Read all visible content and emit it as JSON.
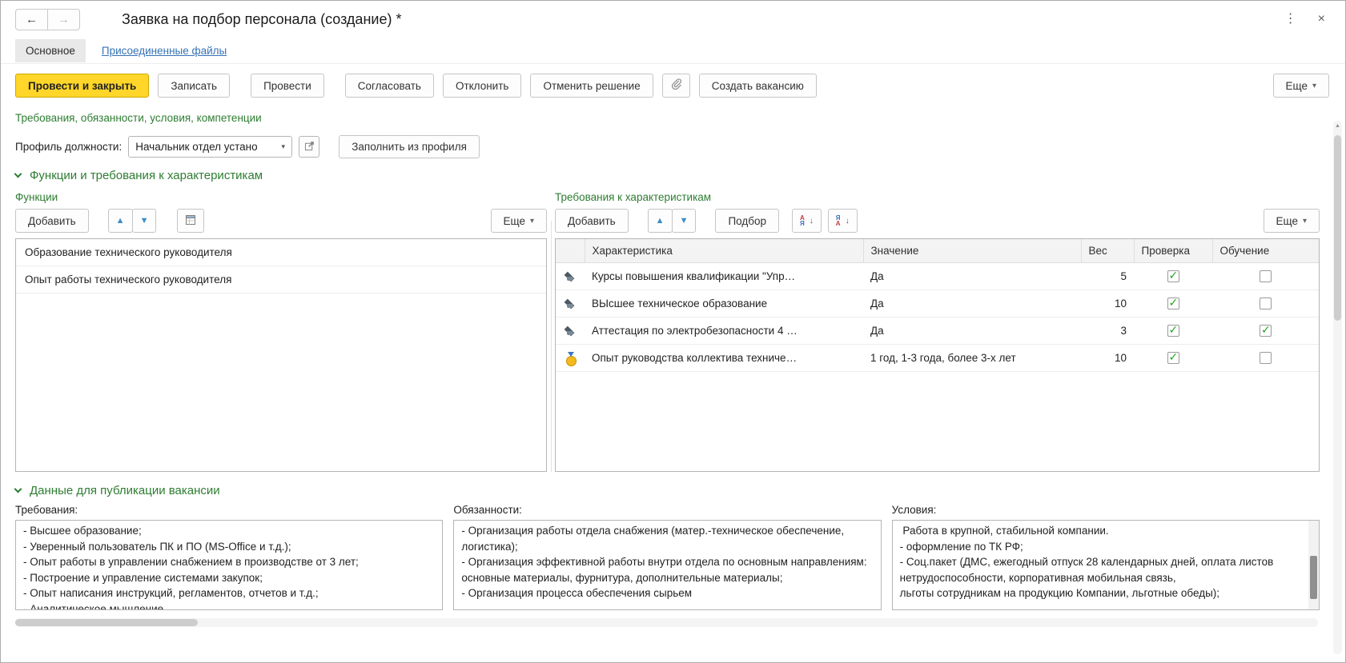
{
  "header": {
    "title": "Заявка на подбор персонала (создание) *"
  },
  "icons": {
    "back": "←",
    "forward": "→",
    "menu_dots": "⋮",
    "close": "×",
    "caret": "▾",
    "up": "▲",
    "down": "▼",
    "scroll_up": "▲",
    "sort_asc_top": "А",
    "sort_asc_bottom": "Я",
    "sort_desc_top": "Я",
    "sort_desc_bottom": "А",
    "sort_arrow": "↓",
    "check": "✓",
    "paperclip": "paperclip-icon",
    "open": "open-icon",
    "list_settings": "list-settings-icon",
    "education": "graduation-cap-icon",
    "medal": "medal-icon",
    "chevron": "chevron-down-icon"
  },
  "tabs": [
    {
      "label": "Основное",
      "active": true
    },
    {
      "label": "Присоединенные файлы",
      "active": false
    }
  ],
  "toolbar": {
    "submit_close": "Провести и закрыть",
    "save": "Записать",
    "post": "Провести",
    "approve": "Согласовать",
    "reject": "Отклонить",
    "cancel_decision": "Отменить решение",
    "create_vacancy": "Создать вакансию",
    "more": "Еще"
  },
  "links": {
    "requirements_link": "Требования, обязанности, условия, компетенции"
  },
  "profile": {
    "label": "Профиль должности:",
    "value": "Начальник отдел устано",
    "fill_button": "Заполнить из профиля"
  },
  "sections": {
    "functions_requirements": "Функции и требования к характеристикам",
    "vacancy_publication": "Данные для публикации вакансии"
  },
  "functions": {
    "title": "Функции",
    "add": "Добавить",
    "more": "Еще",
    "items": [
      "Образование технического руководителя",
      "Опыт работы технического руководителя"
    ]
  },
  "characteristics": {
    "title": "Требования к характеристикам",
    "add": "Добавить",
    "pick": "Подбор",
    "more": "Еще",
    "columns": [
      "Характеристика",
      "Значение",
      "Вес",
      "Проверка",
      "Обучение"
    ],
    "rows": [
      {
        "icon": "education",
        "name": "Курсы повышения квалификации \"Упр…",
        "value": "Да",
        "weight": 5,
        "check": true,
        "training": false
      },
      {
        "icon": "education",
        "name": "ВЫсшее техническое образование",
        "value": "Да",
        "weight": 10,
        "check": true,
        "training": false
      },
      {
        "icon": "education",
        "name": "Аттестация по электробезопасности 4 …",
        "value": "Да",
        "weight": 3,
        "check": true,
        "training": true
      },
      {
        "icon": "medal",
        "name": "Опыт руководства коллектива техниче…",
        "value": "1 год, 1-3 года, более 3-х лет",
        "weight": 10,
        "check": true,
        "training": false
      }
    ]
  },
  "publication": {
    "requirements_label": "Требования:",
    "duties_label": "Обязанности:",
    "conditions_label": "Условия:",
    "requirements_text": "- Высшее образование;\n- Уверенный пользователь ПК и ПО (MS-Office и т.д.);\n- Опыт работы в управлении снабжением в производстве от 3 лет;\n- Построение и управление системами закупок;\n- Опыт написания инструкций, регламентов, отчетов и т.д.;\n- Аналитическое мышление,",
    "duties_text": "- Организация работы отдела снабжения (матер.-техническое обеспечение, логистика);\n- Организация эффективной работы внутри отдела по основным направлениям: основные материалы, фурнитура, дополнительные материалы;\n- Организация процесса обеспечения сырьем",
    "conditions_text": " Работа в крупной, стабильной компании.\n- оформление по ТК РФ;\n- Соц.пакет (ДМС, ежегодный отпуск 28 календарных дней, оплата листов нетрудоспособности, корпоративная мобильная связь,\nльготы сотрудникам на продукцию Компании, льготные обеды);"
  },
  "colors": {
    "accent_yellow": "#ffd629",
    "green": "#2e7d32",
    "link_blue": "#3672b5",
    "check_green": "#1ea81e"
  }
}
